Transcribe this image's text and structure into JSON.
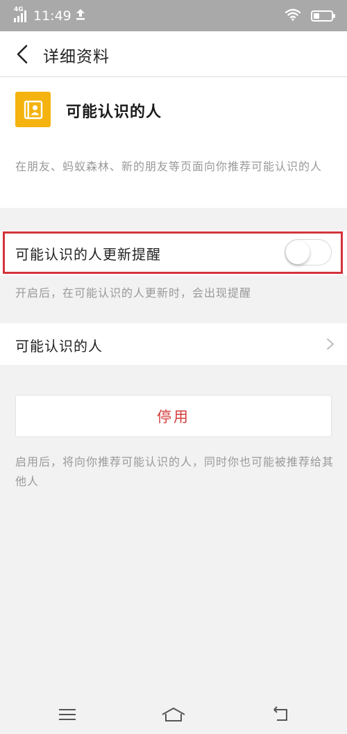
{
  "status_bar": {
    "network": "4G",
    "time": "11:49",
    "upload_icon": "upload-arrow-icon",
    "wifi_icon": "wifi-icon",
    "battery_icon": "battery-icon"
  },
  "nav": {
    "back_icon": "chevron-left-icon",
    "title": "详细资料"
  },
  "profile": {
    "icon": "contact-book-icon",
    "icon_color": "#f4b30e",
    "name": "可能认识的人",
    "description": "在朋友、蚂蚁森林、新的朋友等页面向你推荐可能认识的人"
  },
  "update_reminder": {
    "label": "可能认识的人更新提醒",
    "enabled": false,
    "hint": "开启后，在可能认识的人更新时，会出现提醒",
    "highlight_color": "#d3333b"
  },
  "people_row": {
    "label": "可能认识的人",
    "chevron_icon": "chevron-right-icon"
  },
  "disable": {
    "button_label": "停用",
    "button_color": "#d33c3c",
    "hint": "启用后，将向你推荐可能认识的人，同时你也可能被推荐给其他人"
  },
  "system_nav": {
    "menu_icon": "menu-icon",
    "home_icon": "home-icon",
    "back_icon": "back-icon"
  }
}
